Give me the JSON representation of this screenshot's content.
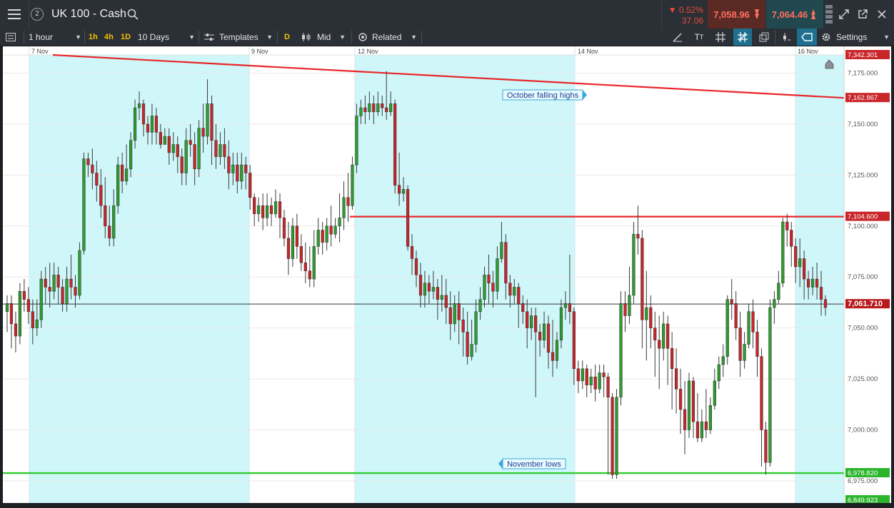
{
  "header": {
    "menu_icon": "hamburger-menu-icon",
    "layout_number": "2",
    "title": "UK 100 - Cash",
    "search_icon": "search-icon"
  },
  "quote": {
    "change_pct": "▼ 0.52%",
    "change_abs": "37.06",
    "sell": "7,058.96",
    "buy": "7,064.46"
  },
  "window_controls": {
    "expand_icon": "expand-icon",
    "popout_icon": "popout-icon",
    "close_icon": "close-icon"
  },
  "toolbar": {
    "interval": "1 hour",
    "quick_intervals": [
      "1h",
      "4h",
      "1D"
    ],
    "range": "10 Days",
    "templates": "Templates",
    "chart_type_label": "D",
    "price_type": "Mid",
    "related": "Related",
    "settings": "Settings",
    "tool_icons": [
      "draw-icon",
      "text-size-icon",
      "grid-icon",
      "crosshair-icon",
      "layers-icon",
      "candle-icon",
      "tag-icon"
    ]
  },
  "chart_data": {
    "type": "candlestick",
    "date_labels": [
      "7 Nov",
      "9 Nov",
      "12 Nov",
      "14 Nov",
      "16 Nov"
    ],
    "y_ticks": [
      "7,175.000",
      "7,150.000",
      "7,125.000",
      "7,100.000",
      "7,075.000",
      "7,050.000",
      "7,025.000",
      "7,000.000",
      "6,975.000"
    ],
    "ylim": [
      6965,
      7200
    ],
    "price_tags": {
      "top": "7,342.301",
      "falling_highs_line": "7,162.867",
      "resistance": "7,104.600",
      "current": "7,061.710",
      "november_lows": "6,978.820",
      "bottom": "6,849.923"
    },
    "annotations": [
      "October falling highs",
      "November lows"
    ],
    "lines": {
      "falling_highs": {
        "from": 7191,
        "to": 7162.867,
        "color": "#e8262a"
      },
      "resistance": {
        "value": 7104.6,
        "color": "#e8262a"
      },
      "november_lows": {
        "value": 6978.82,
        "color": "#2fcc2f"
      },
      "current": {
        "value": 7061.71,
        "color": "#333333"
      }
    },
    "colors": {
      "up": "#2e9c2e",
      "down": "#c8262a",
      "shade": "#cff7fa"
    },
    "candles": [
      [
        7058,
        7062,
        7048,
        7066
      ],
      [
        7062,
        7052,
        7040,
        7066
      ],
      [
        7052,
        7046,
        7038,
        7058
      ],
      [
        7046,
        7068,
        7042,
        7072
      ],
      [
        7068,
        7064,
        7058,
        7074
      ],
      [
        7064,
        7058,
        7052,
        7070
      ],
      [
        7058,
        7050,
        7042,
        7064
      ],
      [
        7050,
        7054,
        7046,
        7064
      ],
      [
        7054,
        7074,
        7050,
        7078
      ],
      [
        7074,
        7070,
        7062,
        7080
      ],
      [
        7070,
        7068,
        7060,
        7082
      ],
      [
        7068,
        7076,
        7064,
        7082
      ],
      [
        7076,
        7070,
        7062,
        7080
      ],
      [
        7070,
        7062,
        7058,
        7074
      ],
      [
        7062,
        7074,
        7058,
        7080
      ],
      [
        7074,
        7070,
        7064,
        7086
      ],
      [
        7070,
        7066,
        7060,
        7076
      ],
      [
        7066,
        7088,
        7064,
        7092
      ],
      [
        7088,
        7133,
        7086,
        7136
      ],
      [
        7133,
        7130,
        7124,
        7136
      ],
      [
        7130,
        7126,
        7118,
        7138
      ],
      [
        7126,
        7120,
        7112,
        7132
      ],
      [
        7120,
        7110,
        7104,
        7128
      ],
      [
        7110,
        7100,
        7094,
        7124
      ],
      [
        7100,
        7094,
        7090,
        7110
      ],
      [
        7094,
        7110,
        7090,
        7118
      ],
      [
        7110,
        7130,
        7106,
        7134
      ],
      [
        7130,
        7122,
        7116,
        7136
      ],
      [
        7122,
        7128,
        7120,
        7140
      ],
      [
        7128,
        7142,
        7124,
        7146
      ],
      [
        7142,
        7158,
        7138,
        7162
      ],
      [
        7158,
        7160,
        7152,
        7166
      ],
      [
        7160,
        7150,
        7144,
        7162
      ],
      [
        7150,
        7146,
        7140,
        7154
      ],
      [
        7146,
        7154,
        7140,
        7160
      ],
      [
        7154,
        7146,
        7140,
        7158
      ],
      [
        7146,
        7140,
        7138,
        7150
      ],
      [
        7140,
        7144,
        7140,
        7148
      ],
      [
        7144,
        7136,
        7130,
        7148
      ],
      [
        7136,
        7140,
        7132,
        7146
      ],
      [
        7140,
        7134,
        7126,
        7144
      ],
      [
        7134,
        7126,
        7120,
        7138
      ],
      [
        7126,
        7142,
        7120,
        7148
      ],
      [
        7142,
        7140,
        7134,
        7150
      ],
      [
        7140,
        7128,
        7120,
        7146
      ],
      [
        7128,
        7148,
        7124,
        7152
      ],
      [
        7148,
        7144,
        7136,
        7160
      ],
      [
        7144,
        7160,
        7140,
        7172
      ],
      [
        7160,
        7142,
        7130,
        7164
      ],
      [
        7142,
        7134,
        7128,
        7150
      ],
      [
        7134,
        7140,
        7130,
        7146
      ],
      [
        7140,
        7134,
        7128,
        7148
      ],
      [
        7134,
        7126,
        7118,
        7142
      ],
      [
        7126,
        7130,
        7120,
        7136
      ],
      [
        7130,
        7122,
        7116,
        7136
      ],
      [
        7122,
        7130,
        7118,
        7136
      ],
      [
        7130,
        7126,
        7118,
        7134
      ],
      [
        7126,
        7114,
        7108,
        7130
      ],
      [
        7114,
        7106,
        7100,
        7116
      ],
      [
        7106,
        7110,
        7102,
        7114
      ],
      [
        7110,
        7104,
        7098,
        7116
      ],
      [
        7104,
        7110,
        7100,
        7116
      ],
      [
        7110,
        7106,
        7100,
        7114
      ],
      [
        7106,
        7112,
        7104,
        7118
      ],
      [
        7112,
        7104,
        7094,
        7116
      ],
      [
        7104,
        7094,
        7090,
        7108
      ],
      [
        7094,
        7084,
        7076,
        7102
      ],
      [
        7084,
        7100,
        7080,
        7104
      ],
      [
        7100,
        7090,
        7084,
        7106
      ],
      [
        7090,
        7082,
        7078,
        7096
      ],
      [
        7082,
        7078,
        7072,
        7092
      ],
      [
        7078,
        7074,
        7070,
        7090
      ],
      [
        7074,
        7090,
        7070,
        7098
      ],
      [
        7090,
        7098,
        7086,
        7104
      ],
      [
        7098,
        7092,
        7086,
        7102
      ],
      [
        7092,
        7100,
        7088,
        7104
      ],
      [
        7100,
        7096,
        7090,
        7110
      ],
      [
        7096,
        7100,
        7094,
        7104
      ],
      [
        7100,
        7104,
        7092,
        7116
      ],
      [
        7104,
        7114,
        7098,
        7122
      ],
      [
        7114,
        7110,
        7102,
        7126
      ],
      [
        7110,
        7130,
        7108,
        7134
      ],
      [
        7130,
        7154,
        7126,
        7160
      ],
      [
        7154,
        7158,
        7150,
        7162
      ],
      [
        7158,
        7156,
        7150,
        7164
      ],
      [
        7156,
        7160,
        7152,
        7166
      ],
      [
        7160,
        7156,
        7150,
        7164
      ],
      [
        7156,
        7160,
        7154,
        7166
      ],
      [
        7160,
        7158,
        7154,
        7164
      ],
      [
        7158,
        7156,
        7152,
        7176
      ],
      [
        7156,
        7160,
        7154,
        7166
      ],
      [
        7160,
        7120,
        7116,
        7162
      ],
      [
        7120,
        7116,
        7110,
        7136
      ],
      [
        7116,
        7118,
        7112,
        7124
      ],
      [
        7118,
        7090,
        7088,
        7120
      ],
      [
        7090,
        7084,
        7076,
        7096
      ],
      [
        7084,
        7076,
        7070,
        7088
      ],
      [
        7076,
        7066,
        7060,
        7082
      ],
      [
        7066,
        7072,
        7060,
        7078
      ],
      [
        7072,
        7068,
        7062,
        7076
      ],
      [
        7068,
        7070,
        7064,
        7078
      ],
      [
        7070,
        7064,
        7054,
        7074
      ],
      [
        7064,
        7066,
        7058,
        7076
      ],
      [
        7066,
        7060,
        7052,
        7074
      ],
      [
        7060,
        7052,
        7044,
        7068
      ],
      [
        7052,
        7062,
        7048,
        7066
      ],
      [
        7062,
        7054,
        7042,
        7068
      ],
      [
        7054,
        7048,
        7036,
        7060
      ],
      [
        7048,
        7036,
        7032,
        7058
      ],
      [
        7036,
        7042,
        7034,
        7054
      ],
      [
        7042,
        7058,
        7038,
        7064
      ],
      [
        7058,
        7064,
        7054,
        7070
      ],
      [
        7064,
        7076,
        7060,
        7080
      ],
      [
        7076,
        7072,
        7062,
        7086
      ],
      [
        7072,
        7068,
        7060,
        7078
      ],
      [
        7068,
        7084,
        7064,
        7090
      ],
      [
        7084,
        7092,
        7082,
        7102
      ],
      [
        7092,
        7072,
        7064,
        7096
      ],
      [
        7072,
        7066,
        7060,
        7076
      ],
      [
        7066,
        7070,
        7062,
        7074
      ],
      [
        7070,
        7062,
        7050,
        7072
      ],
      [
        7062,
        7058,
        7052,
        7066
      ],
      [
        7058,
        7050,
        7040,
        7064
      ],
      [
        7050,
        7056,
        7044,
        7060
      ],
      [
        7056,
        7048,
        7016,
        7060
      ],
      [
        7048,
        7044,
        7036,
        7052
      ],
      [
        7044,
        7052,
        7040,
        7058
      ],
      [
        7052,
        7038,
        7030,
        7056
      ],
      [
        7038,
        7034,
        7026,
        7054
      ],
      [
        7034,
        7044,
        7030,
        7048
      ],
      [
        7044,
        7060,
        7040,
        7064
      ],
      [
        7060,
        7062,
        7054,
        7068
      ],
      [
        7062,
        7058,
        7052,
        7086
      ],
      [
        7058,
        7030,
        7022,
        7060
      ],
      [
        7030,
        7024,
        7018,
        7034
      ],
      [
        7024,
        7030,
        7020,
        7034
      ],
      [
        7030,
        7022,
        7016,
        7032
      ],
      [
        7022,
        7026,
        7018,
        7030
      ],
      [
        7026,
        7020,
        7014,
        7032
      ],
      [
        7020,
        7028,
        7018,
        7032
      ],
      [
        7028,
        7026,
        7016,
        7032
      ],
      [
        7026,
        7016,
        6978,
        7028
      ],
      [
        7016,
        6978,
        6976,
        7018
      ],
      [
        6978,
        7016,
        6976,
        7020
      ],
      [
        7016,
        7062,
        7012,
        7068
      ],
      [
        7062,
        7056,
        7048,
        7068
      ],
      [
        7056,
        7066,
        7052,
        7080
      ],
      [
        7066,
        7096,
        7062,
        7102
      ],
      [
        7096,
        7094,
        7086,
        7110
      ],
      [
        7094,
        7054,
        7040,
        7098
      ],
      [
        7054,
        7060,
        7034,
        7078
      ],
      [
        7060,
        7050,
        7040,
        7066
      ],
      [
        7050,
        7044,
        7026,
        7058
      ],
      [
        7044,
        7040,
        7020,
        7056
      ],
      [
        7040,
        7052,
        7034,
        7058
      ],
      [
        7052,
        7040,
        7022,
        7056
      ],
      [
        7040,
        7030,
        7010,
        7048
      ],
      [
        7030,
        7020,
        7008,
        7040
      ],
      [
        7020,
        7010,
        6998,
        7030
      ],
      [
        7010,
        7000,
        6988,
        7024
      ],
      [
        7000,
        7024,
        6996,
        7028
      ],
      [
        7024,
        7004,
        6996,
        7026
      ],
      [
        7004,
        6996,
        6994,
        7018
      ],
      [
        6996,
        7004,
        6994,
        7010
      ],
      [
        7004,
        7000,
        6996,
        7020
      ],
      [
        7000,
        7012,
        6998,
        7016
      ],
      [
        7012,
        7024,
        7010,
        7030
      ],
      [
        7024,
        7032,
        7020,
        7036
      ],
      [
        7032,
        7036,
        7026,
        7042
      ],
      [
        7036,
        7064,
        7032,
        7066
      ],
      [
        7064,
        7062,
        7054,
        7074
      ],
      [
        7062,
        7050,
        7044,
        7068
      ],
      [
        7050,
        7034,
        7026,
        7058
      ],
      [
        7034,
        7042,
        7030,
        7048
      ],
      [
        7042,
        7058,
        7040,
        7062
      ],
      [
        7058,
        7048,
        7040,
        7064
      ],
      [
        7048,
        7036,
        7026,
        7054
      ],
      [
        7036,
        7000,
        6982,
        7040
      ],
      [
        7000,
        6984,
        6978,
        7004
      ],
      [
        6984,
        7060,
        6982,
        7064
      ],
      [
        7060,
        7064,
        7052,
        7068
      ],
      [
        7064,
        7072,
        7062,
        7078
      ],
      [
        7072,
        7102,
        7070,
        7104
      ],
      [
        7102,
        7098,
        7090,
        7106
      ],
      [
        7098,
        7090,
        7080,
        7102
      ],
      [
        7090,
        7080,
        7072,
        7094
      ],
      [
        7080,
        7084,
        7070,
        7094
      ],
      [
        7084,
        7074,
        7064,
        7088
      ],
      [
        7074,
        7070,
        7064,
        7078
      ],
      [
        7070,
        7074,
        7066,
        7080
      ],
      [
        7074,
        7070,
        7064,
        7082
      ],
      [
        7070,
        7064,
        7056,
        7078
      ],
      [
        7064,
        7060,
        7056,
        7066
      ]
    ]
  }
}
